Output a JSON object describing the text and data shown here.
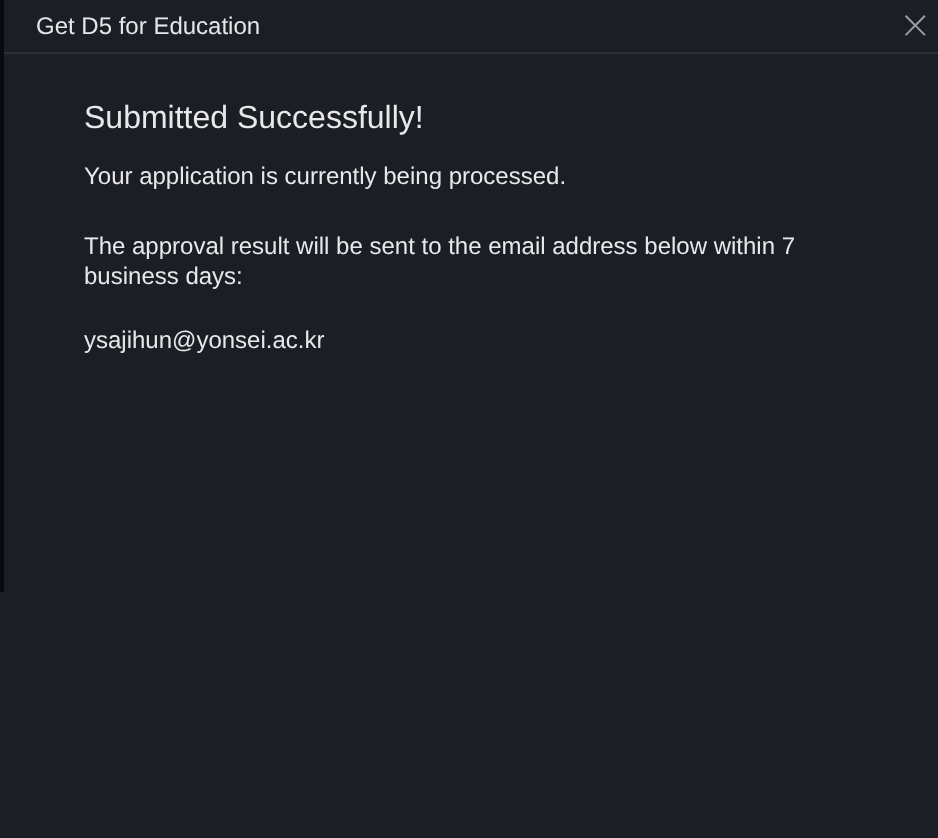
{
  "window": {
    "title": "Get D5 for Education",
    "close": "×"
  },
  "message": {
    "heading": "Submitted Successfully!",
    "status": "Your application is currently being processed.",
    "note": "The approval result will be sent to the email address below within 7 business days:",
    "email": "ysajihun@yonsei.ac.kr"
  }
}
